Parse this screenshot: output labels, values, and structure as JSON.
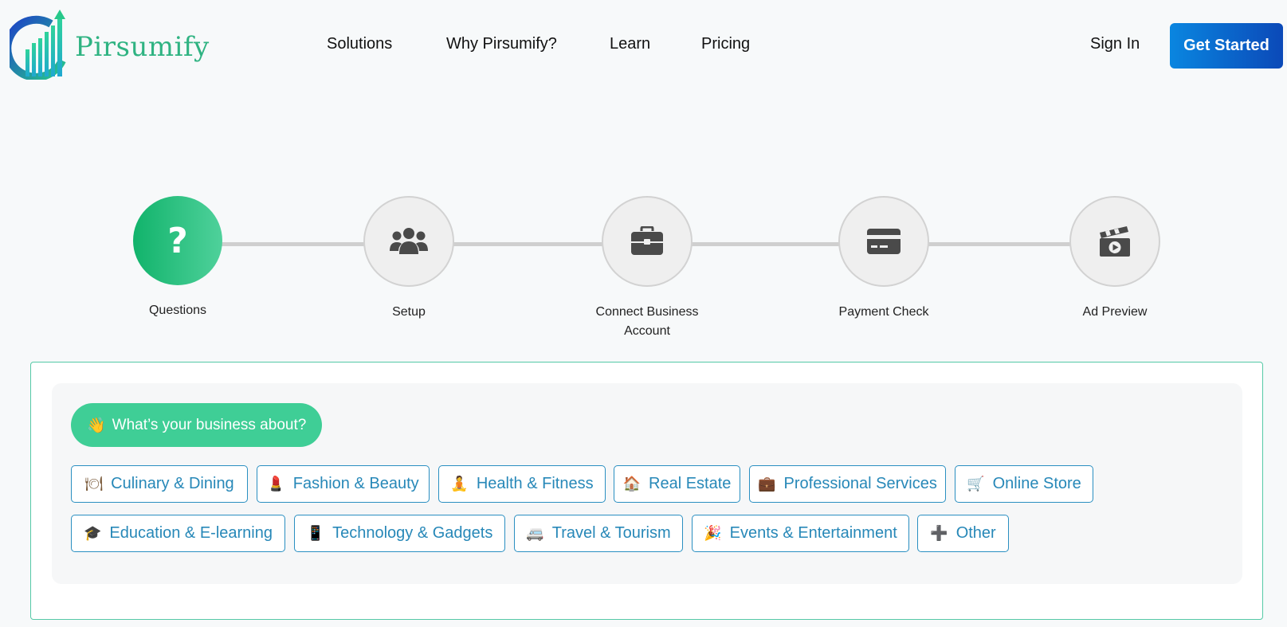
{
  "brand": {
    "name": "Pirsumify"
  },
  "nav": {
    "items": [
      {
        "label": "Solutions"
      },
      {
        "label": "Why Pirsumify?"
      },
      {
        "label": "Learn"
      },
      {
        "label": "Pricing"
      }
    ],
    "sign_in": "Sign In",
    "get_started": "Get Started"
  },
  "stepper": {
    "active_index": 0,
    "steps": [
      {
        "label": "Questions",
        "icon": "question-mark-icon"
      },
      {
        "label": "Setup",
        "icon": "users-icon"
      },
      {
        "label": "Connect Business Account",
        "icon": "briefcase-icon"
      },
      {
        "label": "Payment Check",
        "icon": "credit-card-icon"
      },
      {
        "label": "Ad Preview",
        "icon": "clapperboard-icon"
      }
    ]
  },
  "question": {
    "emoji": "👋",
    "text": "What’s your business about?"
  },
  "options": [
    {
      "icon": "🍽",
      "label": "Culinary & Dining"
    },
    {
      "icon": "💄",
      "label": "Fashion & Beauty"
    },
    {
      "icon": "🧘",
      "label": "Health & Fitness"
    },
    {
      "icon": "🏠",
      "label": "Real Estate"
    },
    {
      "icon": "💼",
      "label": "Professional Services"
    },
    {
      "icon": "🛒",
      "label": "Online Store"
    },
    {
      "icon": "🎓",
      "label": "Education & E-learning"
    },
    {
      "icon": "📱",
      "label": "Technology & Gadgets"
    },
    {
      "icon": "🚐",
      "label": "Travel & Tourism"
    },
    {
      "icon": "🎉",
      "label": "Events & Entertainment"
    },
    {
      "icon": "➕",
      "label": "Other"
    }
  ],
  "colors": {
    "accent_green": "#3fce96",
    "chip_blue": "#2788b8",
    "button_blue": "#0a86e0"
  }
}
